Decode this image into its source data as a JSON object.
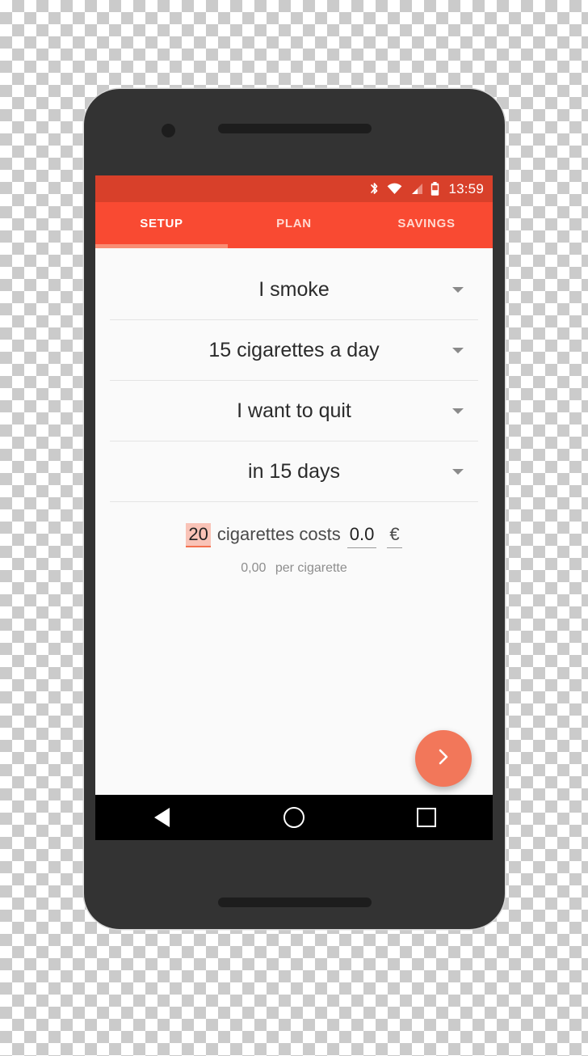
{
  "device": {
    "frame_color": "#333333",
    "camera_icon": "camera-dot",
    "earpiece_icon": "earpiece-speaker-grill",
    "bottom_speaker_icon": "bottom-speaker-grill"
  },
  "status_bar": {
    "background": "#d8402a",
    "time": "13:59",
    "icons": [
      "bluetooth-icon",
      "wifi-icon",
      "cellular-signal-icon",
      "battery-icon"
    ]
  },
  "tabs": {
    "background": "#f94a32",
    "indicator_color": "#f98d74",
    "active_index": 0,
    "items": [
      {
        "label": "SETUP"
      },
      {
        "label": "PLAN"
      },
      {
        "label": "SAVINGS"
      }
    ]
  },
  "form": {
    "rows": [
      {
        "value": "I smoke",
        "caret": "chevron-down-icon"
      },
      {
        "value": "15 cigarettes a day",
        "caret": "chevron-down-icon"
      },
      {
        "value": "I want to quit",
        "caret": "chevron-down-icon"
      },
      {
        "value": "in 15 days",
        "caret": "chevron-down-icon"
      }
    ]
  },
  "cost": {
    "quantity": "20",
    "quantity_selected": true,
    "label": "cigarettes costs",
    "price": "0.0",
    "currency": "€",
    "per_unit_value": "0,00",
    "per_unit_label": "per cigarette",
    "highlight_color": "#f9c3b7",
    "underline_color": "#f4714f"
  },
  "fab": {
    "icon": "chevron-right-icon",
    "color": "#f2775a"
  },
  "nav_bar": {
    "background": "#000000",
    "buttons": [
      {
        "icon": "back-triangle-icon"
      },
      {
        "icon": "home-circle-icon"
      },
      {
        "icon": "recents-square-icon"
      }
    ]
  }
}
